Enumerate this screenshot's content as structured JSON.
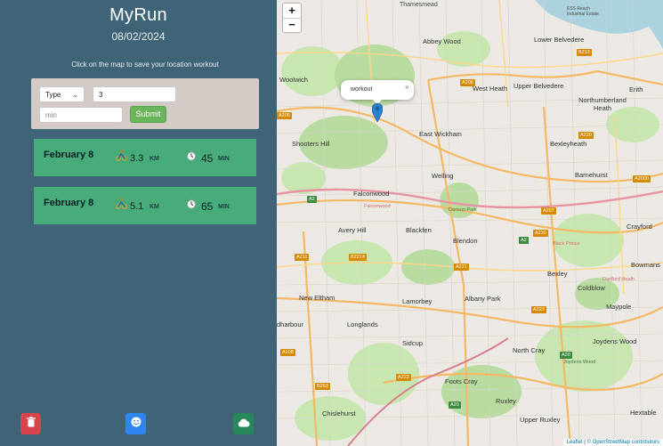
{
  "app": {
    "title": "MyRun",
    "date": "08/02/2024",
    "instruction": "Click on the map to save your location workout"
  },
  "form": {
    "type_select": "Type",
    "distance_value": "3",
    "duration_placeholder": "min",
    "submit_label": "Submit"
  },
  "workouts": [
    {
      "date": "February 8",
      "activity_icon": "cycling-icon",
      "distance": "3.3",
      "distance_unit": "KM",
      "duration": "45",
      "duration_unit": "MIN"
    },
    {
      "date": "February 8",
      "activity_icon": "cycling-icon",
      "distance": "5.1",
      "distance_unit": "KM",
      "duration": "65",
      "duration_unit": "MIN"
    }
  ],
  "actions": {
    "delete_icon": "trash-icon",
    "profile_icon": "smiley-icon",
    "cloud_icon": "cloud-icon"
  },
  "map": {
    "zoom_in": "+",
    "zoom_out": "−",
    "popup_text": "workout",
    "popup_close": "×",
    "attribution_prefix": "Leaflet",
    "attribution_separator": "|",
    "attribution_copy": "© OpenStreetMap contributors",
    "places": [
      {
        "name": "Thamesmead",
        "cls": "big"
      },
      {
        "name": "ESS Reach Industrial Estate",
        "cls": ""
      },
      {
        "name": "Abbey Wood",
        "cls": "big"
      },
      {
        "name": "Lower Belvedere",
        "cls": "big"
      },
      {
        "name": "Woolwich",
        "cls": "big"
      },
      {
        "name": "West Heath",
        "cls": "big"
      },
      {
        "name": "Upper Belvedere",
        "cls": "big"
      },
      {
        "name": "Erith",
        "cls": "big"
      },
      {
        "name": "Northumberland Heath",
        "cls": "big"
      },
      {
        "name": "Shooters Hill",
        "cls": "big"
      },
      {
        "name": "East Wickham",
        "cls": "big"
      },
      {
        "name": "Bexleyheath",
        "cls": "big"
      },
      {
        "name": "Barnehurst",
        "cls": "big"
      },
      {
        "name": "Welling",
        "cls": "big"
      },
      {
        "name": "Falconwood",
        "cls": "big"
      },
      {
        "name": "Crayford",
        "cls": "big"
      },
      {
        "name": "Avery Hill",
        "cls": "big"
      },
      {
        "name": "Blackfen",
        "cls": "big"
      },
      {
        "name": "Blendon",
        "cls": "big"
      },
      {
        "name": "Bexley",
        "cls": "big"
      },
      {
        "name": "Bowmans",
        "cls": "big"
      },
      {
        "name": "Coldblow",
        "cls": "big"
      },
      {
        "name": "New Eltham",
        "cls": "big"
      },
      {
        "name": "Lamorbey",
        "cls": "big"
      },
      {
        "name": "Albany Park",
        "cls": "big"
      },
      {
        "name": "Maypole",
        "cls": "big"
      },
      {
        "name": "dharbour",
        "cls": "big"
      },
      {
        "name": "Longlands",
        "cls": "big"
      },
      {
        "name": "Joydens Wood",
        "cls": "big"
      },
      {
        "name": "Sidcup",
        "cls": "big"
      },
      {
        "name": "North Cray",
        "cls": "big"
      },
      {
        "name": "Foots Cray",
        "cls": "big"
      },
      {
        "name": "Ruxley",
        "cls": "big"
      },
      {
        "name": "Chislehurst",
        "cls": "big"
      },
      {
        "name": "Upper Ruxley",
        "cls": "big"
      },
      {
        "name": "Hextable",
        "cls": "big"
      }
    ],
    "roads": [
      {
        "name": "B213",
        "cls": ""
      },
      {
        "name": "A206",
        "cls": ""
      },
      {
        "name": "A205",
        "cls": ""
      },
      {
        "name": "A220",
        "cls": ""
      },
      {
        "name": "A2000",
        "cls": ""
      },
      {
        "name": "A207",
        "cls": ""
      },
      {
        "name": "A2",
        "cls": "green"
      },
      {
        "name": "A220",
        "cls": ""
      },
      {
        "name": "A2",
        "cls": ""
      },
      {
        "name": "A211",
        "cls": ""
      },
      {
        "name": "B2214",
        "cls": ""
      },
      {
        "name": "A221",
        "cls": ""
      },
      {
        "name": "A223",
        "cls": ""
      },
      {
        "name": "A222",
        "cls": ""
      },
      {
        "name": "A208",
        "cls": ""
      },
      {
        "name": "B263",
        "cls": ""
      },
      {
        "name": "A20",
        "cls": "green"
      },
      {
        "name": "A20",
        "cls": "green"
      }
    ],
    "park_labels": [
      "Danson Park",
      "Joydens Wood"
    ],
    "area_labels": [
      "Dartford Heath",
      "Black Prince",
      "Falconwood"
    ]
  }
}
